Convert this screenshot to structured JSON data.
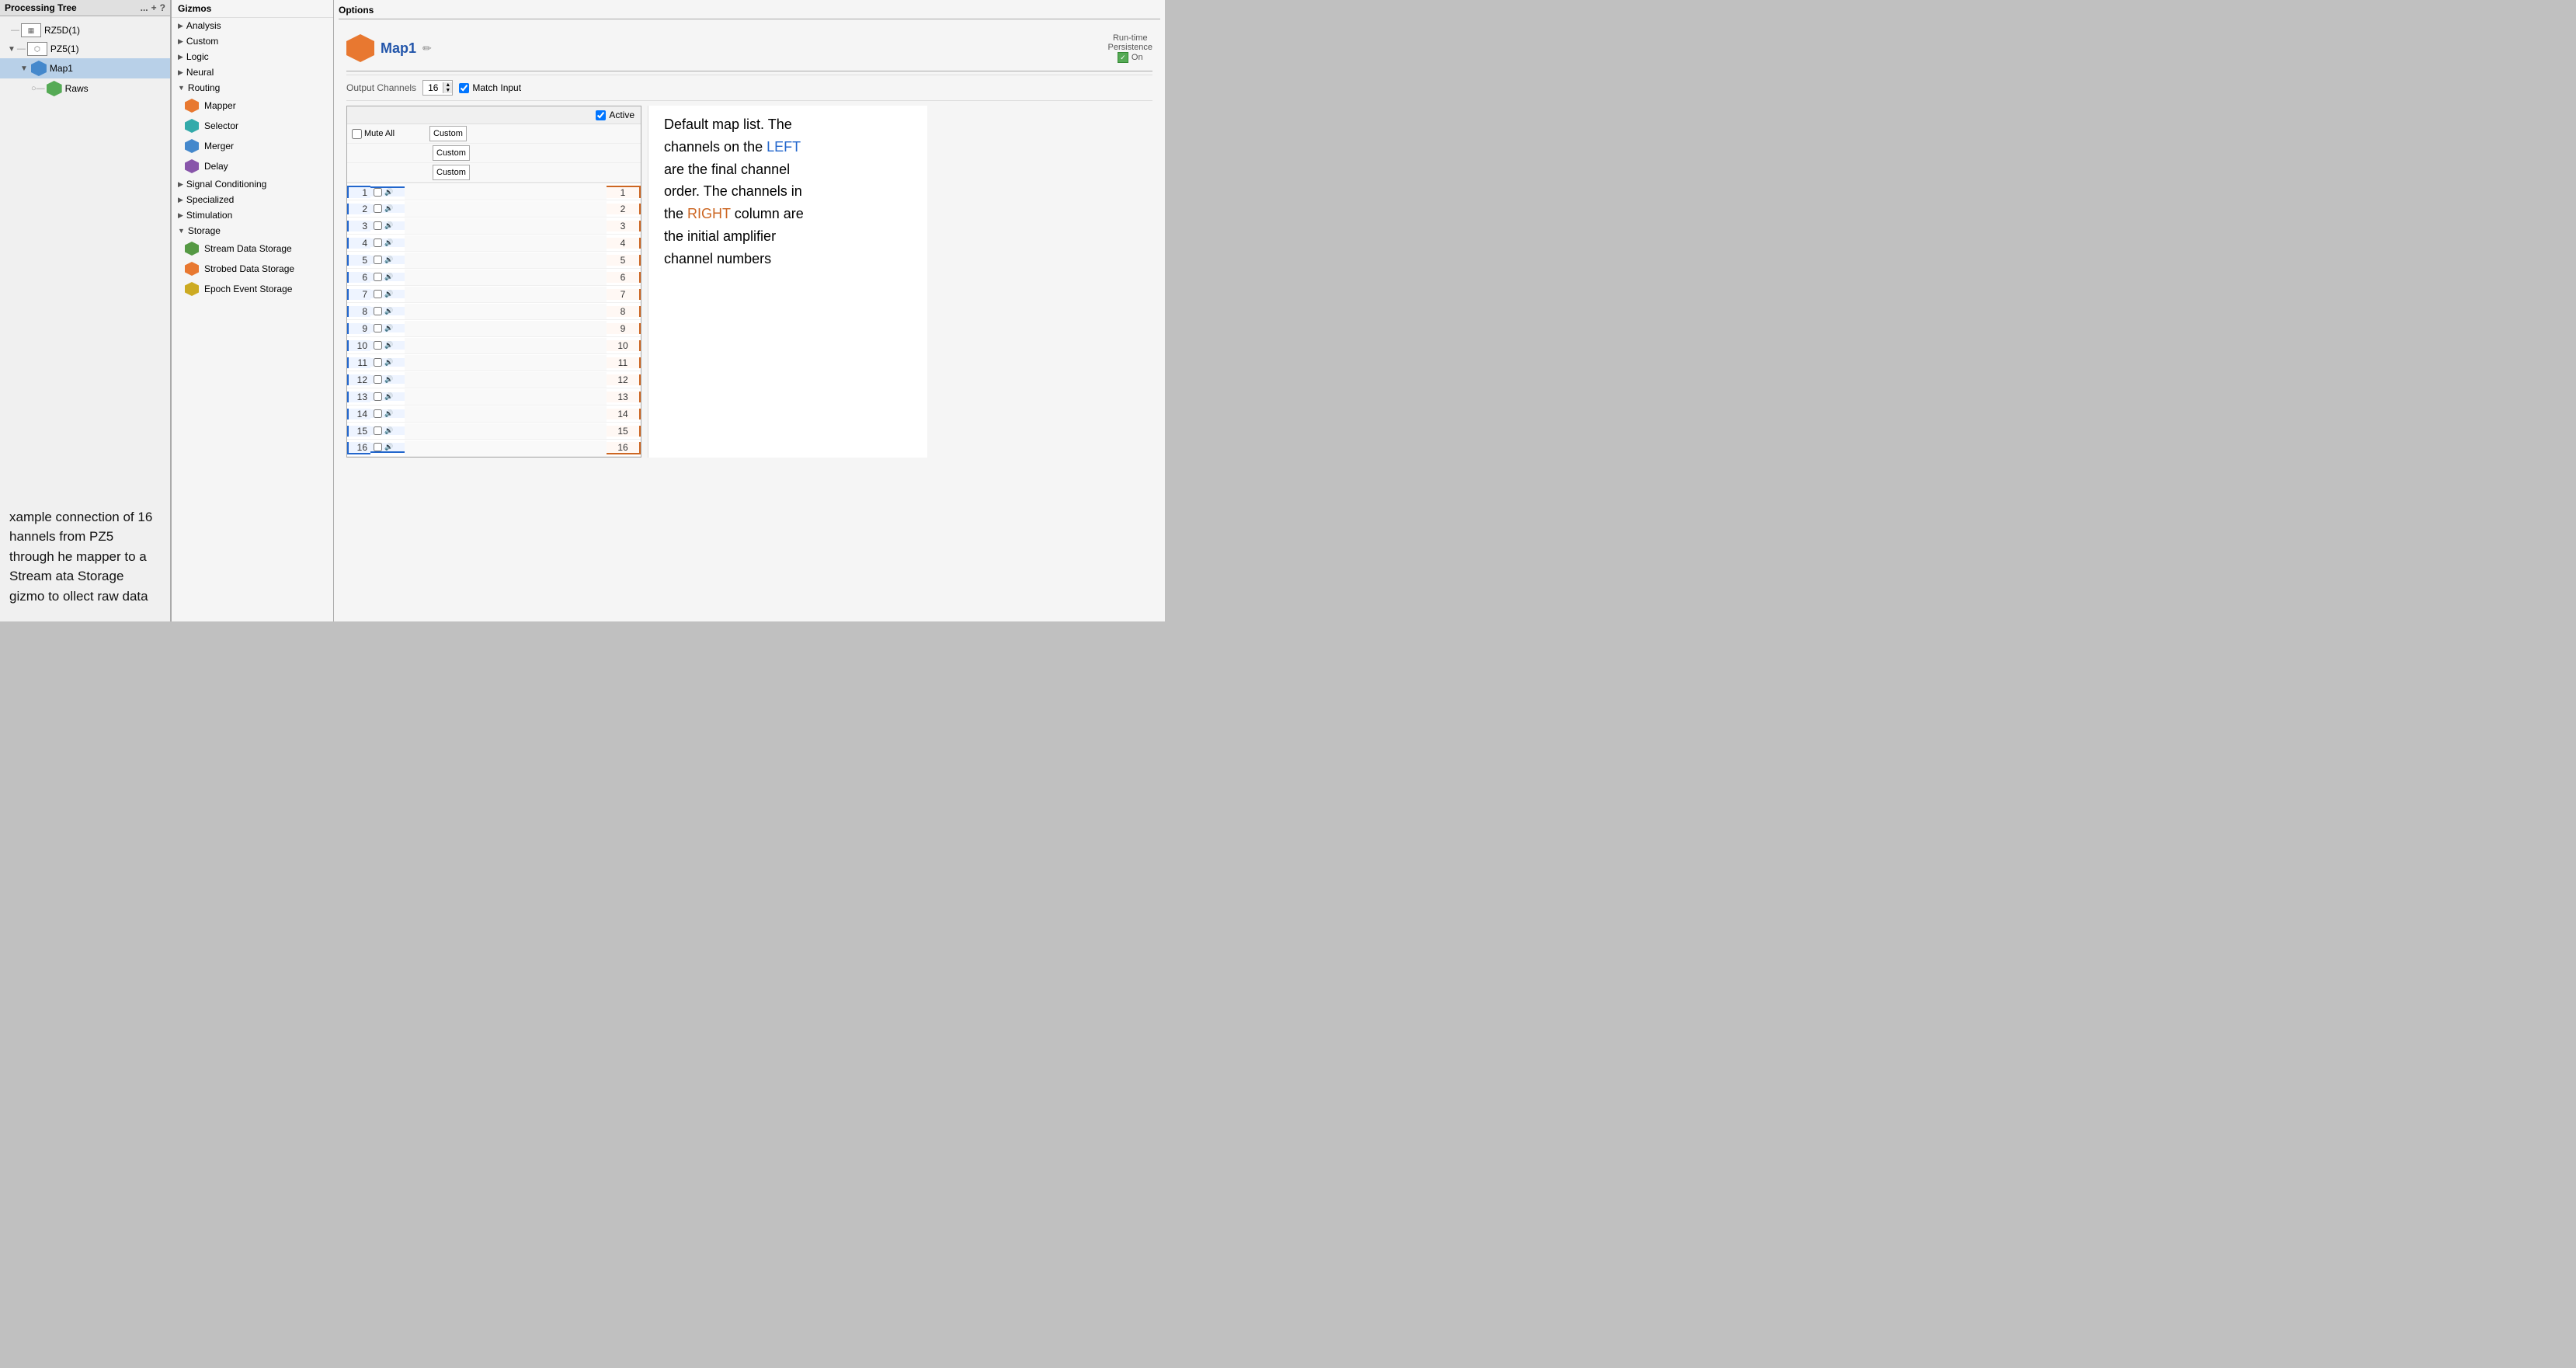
{
  "processingTree": {
    "title": "Processing Tree",
    "icons": [
      "...",
      "+",
      "?"
    ],
    "nodes": [
      {
        "id": "rz5d1",
        "label": "RZ5D(1)",
        "indent": 1,
        "type": "box",
        "selected": false
      },
      {
        "id": "pz5_1",
        "label": "PZ5(1)",
        "indent": 1,
        "type": "circle",
        "selected": false
      },
      {
        "id": "map1",
        "label": "Map1",
        "indent": 2,
        "type": "hex-blue",
        "selected": true
      },
      {
        "id": "raws",
        "label": "Raws",
        "indent": 3,
        "type": "hex-green",
        "selected": false
      }
    ]
  },
  "description": {
    "text": "xample connection of 16\nhannels from PZ5 through\nhe mapper to a Stream\nata Storage gizmo to\nollect raw data"
  },
  "gizmos": {
    "title": "Gizmos",
    "categories": [
      {
        "id": "analysis",
        "label": "Analysis",
        "expanded": false
      },
      {
        "id": "custom",
        "label": "Custom",
        "expanded": false
      },
      {
        "id": "logic",
        "label": "Logic",
        "expanded": false
      },
      {
        "id": "neural",
        "label": "Neural",
        "expanded": false
      },
      {
        "id": "routing",
        "label": "Routing",
        "expanded": true,
        "items": [
          {
            "id": "mapper",
            "label": "Mapper",
            "color": "orange"
          },
          {
            "id": "selector",
            "label": "Selector",
            "color": "teal"
          },
          {
            "id": "merger",
            "label": "Merger",
            "color": "blue"
          },
          {
            "id": "delay",
            "label": "Delay",
            "color": "purple"
          }
        ]
      },
      {
        "id": "signal_conditioning",
        "label": "Signal Conditioning",
        "expanded": false
      },
      {
        "id": "specialized",
        "label": "Specialized",
        "expanded": false
      },
      {
        "id": "stimulation",
        "label": "Stimulation",
        "expanded": false
      },
      {
        "id": "storage",
        "label": "Storage",
        "expanded": true,
        "items": [
          {
            "id": "stream_data_storage",
            "label": "Stream Data Storage",
            "color": "green"
          },
          {
            "id": "strobed_data_storage",
            "label": "Strobed Data Storage",
            "color": "orange"
          },
          {
            "id": "epoch_event_storage",
            "label": "Epoch Event Storage",
            "color": "yellow"
          }
        ]
      }
    ]
  },
  "options": {
    "title": "Options",
    "gizmoName": "Map1",
    "runtimePersistence": "Run-time\nPersistence",
    "runtimeOn": "On",
    "outputChannelsLabel": "Output Channels",
    "outputChannelsValue": "16",
    "matchInput": "Match Input",
    "activeLabel": "Active",
    "muteAll": "Mute All",
    "dropdowns": [
      {
        "id": "d1",
        "value": "Custom"
      },
      {
        "id": "d2",
        "value": "Custom"
      },
      {
        "id": "d3",
        "value": "Custom"
      }
    ],
    "channels": [
      1,
      2,
      3,
      4,
      5,
      6,
      7,
      8,
      9,
      10,
      11,
      12,
      13,
      14,
      15,
      16
    ]
  },
  "annotation": {
    "text1": "Default map list. The\nchannels on the ",
    "leftWord": "LEFT",
    "text2": "\nare the final channel\norder. The channels in\nthe ",
    "rightWord": "RIGHT",
    "text3": " column are\nthe initial amplifier\nchannel numbers"
  }
}
